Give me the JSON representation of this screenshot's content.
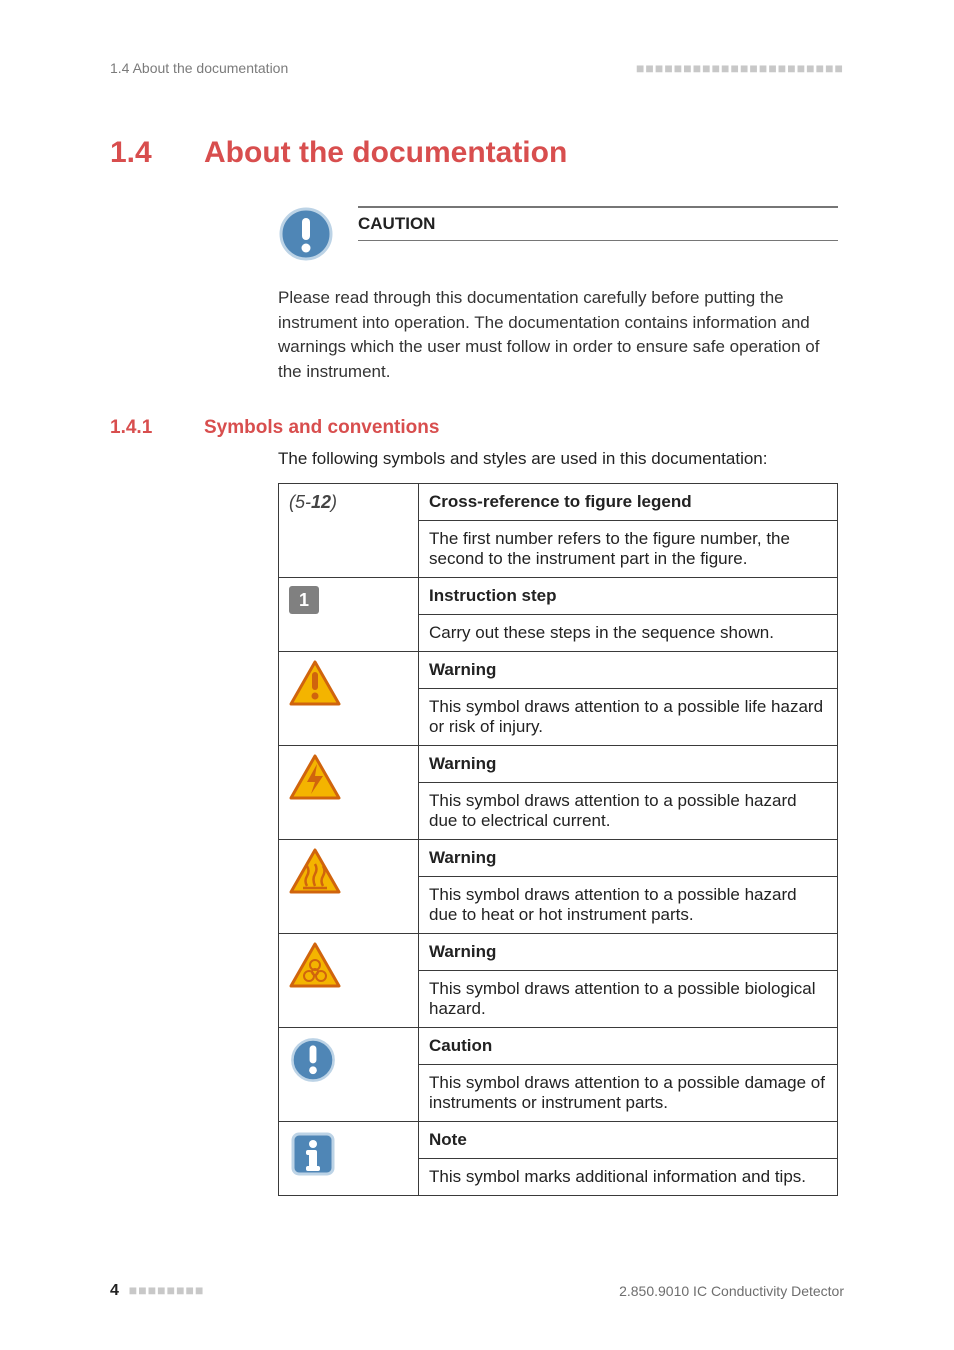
{
  "runhead": {
    "left": "1.4 About the documentation",
    "dashes": "■■■■■■■■■■■■■■■■■■■■■■"
  },
  "h1": {
    "num": "1.4",
    "txt": "About the documentation"
  },
  "caution": {
    "label": "CAUTION",
    "body": "Please read through this documentation carefully before putting the instrument into operation. The documentation contains information and warnings which the user must follow in order to ensure safe operation of the instrument."
  },
  "h2": {
    "num": "1.4.1",
    "txt": "Symbols and conventions"
  },
  "intro": "The following symbols and styles are used in this documentation:",
  "rows": [
    {
      "title": "Cross-reference to figure legend",
      "desc": "The first number refers to the figure number, the second to the instrument part in the figure."
    },
    {
      "title": "Instruction step",
      "desc": "Carry out these steps in the sequence shown."
    },
    {
      "title": "Warning",
      "desc": "This symbol draws attention to a possible life hazard or risk of injury."
    },
    {
      "title": "Warning",
      "desc": "This symbol draws attention to a possible hazard due to electrical current."
    },
    {
      "title": "Warning",
      "desc": "This symbol draws attention to a possible hazard due to heat or hot instrument parts."
    },
    {
      "title": "Warning",
      "desc": "This symbol draws attention to a possible biological hazard."
    },
    {
      "title": "Caution",
      "desc": "This symbol draws attention to a possible damage of instruments or instrument parts."
    },
    {
      "title": "Note",
      "desc": "This symbol marks additional information and tips."
    }
  ],
  "xref": {
    "open": "(5-",
    "bold": "12",
    "close": ")"
  },
  "step1": "1",
  "footer": {
    "page": "4",
    "dashes": "■■■■■■■■",
    "doc": "2.850.9010 IC Conductivity Detector"
  }
}
